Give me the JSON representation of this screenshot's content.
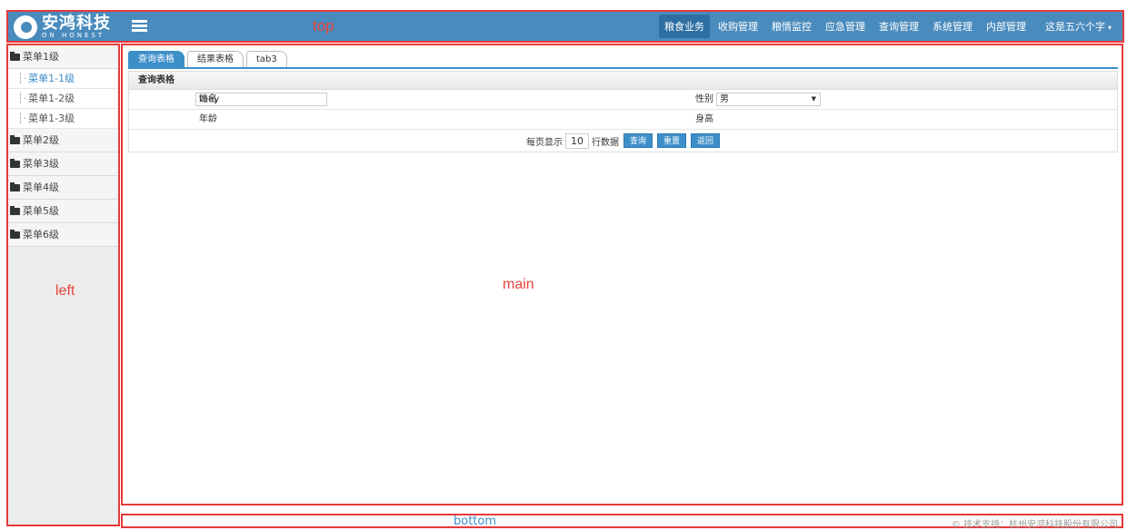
{
  "brand": {
    "name_cn": "安鸿科技",
    "name_en": "ON HONEST"
  },
  "regions": {
    "top": "top",
    "left": "left",
    "main": "main",
    "bottom": "bottom"
  },
  "nav": {
    "items": [
      "粮食业务",
      "收购管理",
      "粮情监控",
      "应急管理",
      "查询管理",
      "系统管理",
      "内部管理"
    ],
    "active": "粮食业务",
    "user": "这是五六个字",
    "user_caret": "▾"
  },
  "sidebar": {
    "menu1": "菜单1级",
    "sub": [
      "菜单1-1级",
      "菜单1-2级",
      "菜单1-3级"
    ],
    "selected_sub": "菜单1-1级",
    "menu2": "菜单2级",
    "menu3": "菜单3级",
    "menu4": "菜单4级",
    "menu5": "菜单5级",
    "menu6": "菜单6级"
  },
  "tabs": [
    "查询表格",
    "结果表格",
    "tab3"
  ],
  "panel": {
    "title": "查询表格",
    "name_label": "姓名",
    "name_value": "tony",
    "sex_label": "性别",
    "sex_value": "男",
    "age_label": "年龄",
    "height_label": "身高",
    "page_size_prefix": "每页显示",
    "page_size": "10",
    "page_size_suffix": "行数据",
    "buttons": [
      "查询",
      "重置",
      "返回"
    ]
  },
  "footer": {
    "copyright": "© 技术支持：杭州安鸿科技股份有限公司"
  },
  "colors": {
    "header_bg": "#4a8bbd",
    "accent": "#3d8fc9",
    "region_border": "#e53a3a"
  }
}
